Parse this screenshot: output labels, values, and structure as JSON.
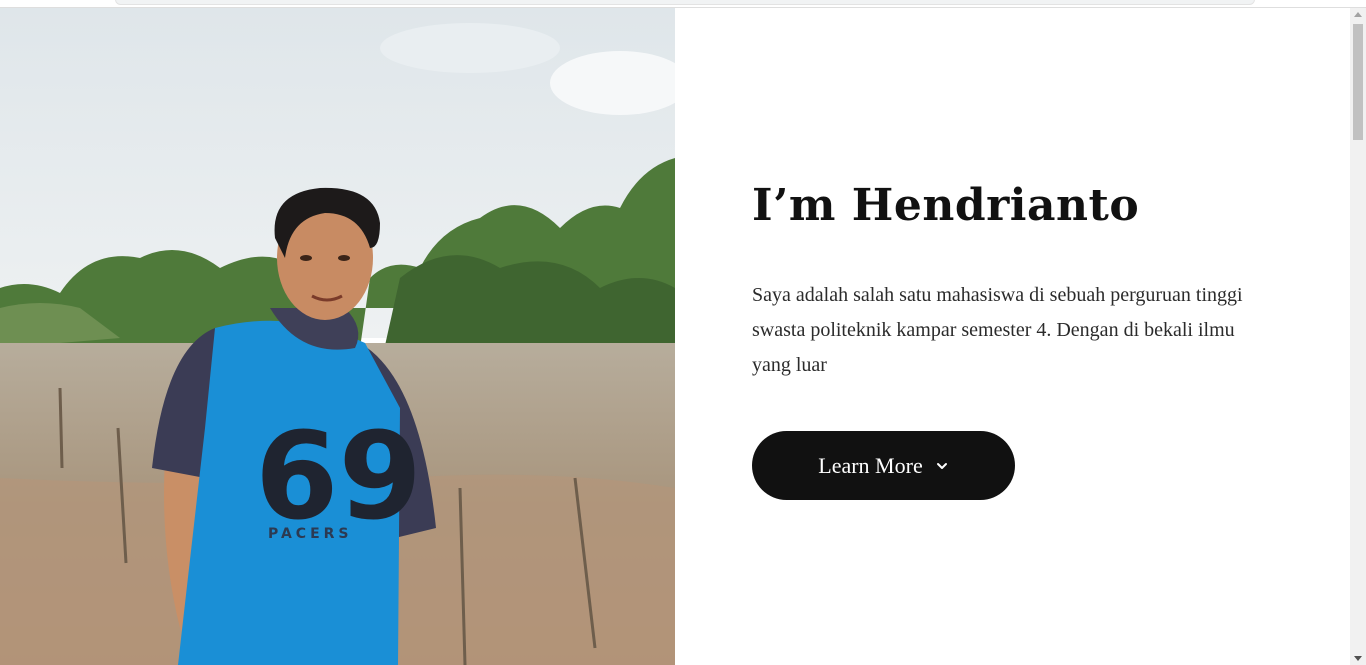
{
  "hero": {
    "title": "I’m Hendrianto",
    "description": "Saya adalah salah satu mahasiswa di sebuah perguruan tinggi swasta politeknik kampar semester 4. Dengan di bekali ilmu yang luar",
    "button_label": "Learn More",
    "button_icon": "chevron-down-icon",
    "photo_icon": "portrait-photo"
  },
  "colors": {
    "button_bg": "#111111",
    "button_text": "#ffffff",
    "title": "#111111",
    "text": "#2b2b2b",
    "shirt": "#1a8fd6"
  }
}
